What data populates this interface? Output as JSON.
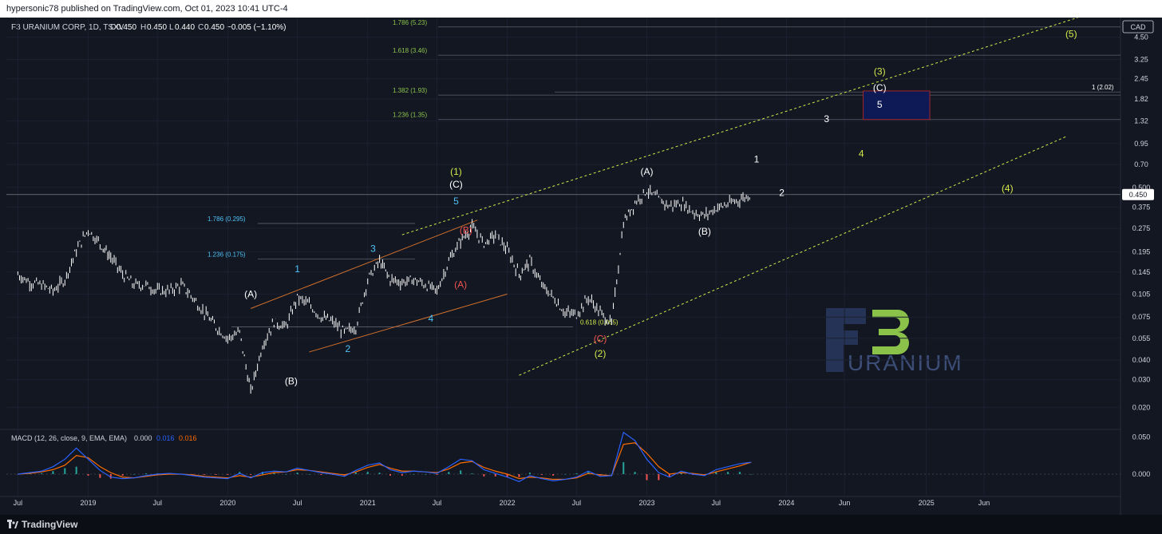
{
  "header": {
    "published": "hypersonic78 published on TradingView.com, Oct 01, 2023 10:41 UTC-4"
  },
  "footer": {
    "brand": "TradingView"
  },
  "legend": {
    "symbol": "F3 URANIUM CORP, 1D, TSXV",
    "o_label": "O",
    "o": "0.450",
    "h_label": "H",
    "h": "0.450",
    "l_label": "L",
    "l": "0.440",
    "c_label": "C",
    "c": "0.450",
    "change": "−0.005 (−1.10%)"
  },
  "currency": "CAD",
  "last_price": "0.450",
  "macd": {
    "label": "MACD (12, 26, close, 9, EMA, EMA)",
    "values": [
      "0.000",
      "0.016",
      "0.016"
    ]
  },
  "watermark": {
    "big": "F3",
    "word": "URANIUM"
  },
  "colors": {
    "background": "#131722",
    "candles": "#ffffff",
    "fib_green": "#8bc34a",
    "fib_cyan": "#4fc3f7",
    "yellow_wave": "#d4e94a",
    "red_wave": "#ef5350",
    "channel_orange": "#d2702c",
    "macd_line": "#2962ff",
    "signal_line": "#ff6d00",
    "target_box_fill": "#0d1a55",
    "target_box_border": "#c62828"
  },
  "chart_data": {
    "type": "candlestick",
    "title": "F3 URANIUM CORP, 1D, TSXV",
    "y_scale": "log",
    "ylim": [
      0.015,
      6.0
    ],
    "y_ticks": [
      "4.50",
      "3.25",
      "2.45",
      "1.82",
      "1.32",
      "0.95",
      "0.70",
      "0.500",
      "0.375",
      "0.275",
      "0.195",
      "0.145",
      "0.105",
      "0.075",
      "0.055",
      "0.040",
      "0.030",
      "0.020"
    ],
    "x_ticks": [
      "Jul",
      "2019",
      "Jul",
      "2020",
      "Jul",
      "2021",
      "Jul",
      "2022",
      "Jul",
      "2023",
      "Jul",
      "2024",
      "Jun",
      "2025",
      "Jun"
    ],
    "price_series": {
      "x": [
        "2018-07-01",
        "2018-08-01",
        "2018-09-01",
        "2018-10-01",
        "2018-11-01",
        "2018-12-01",
        "2019-01-01",
        "2019-02-01",
        "2019-03-01",
        "2019-04-01",
        "2019-05-01",
        "2019-06-01",
        "2019-07-01",
        "2019-08-01",
        "2019-09-01",
        "2019-10-01",
        "2019-11-01",
        "2019-12-01",
        "2020-01-01",
        "2020-02-01",
        "2020-03-01",
        "2020-04-01",
        "2020-05-01",
        "2020-06-01",
        "2020-07-01",
        "2020-08-01",
        "2020-09-01",
        "2020-10-01",
        "2020-11-01",
        "2020-12-01",
        "2021-01-01",
        "2021-02-01",
        "2021-03-01",
        "2021-04-01",
        "2021-05-01",
        "2021-06-01",
        "2021-07-01",
        "2021-08-01",
        "2021-09-01",
        "2021-10-01",
        "2021-11-01",
        "2021-12-01",
        "2022-01-01",
        "2022-02-01",
        "2022-03-01",
        "2022-04-01",
        "2022-05-01",
        "2022-06-01",
        "2022-07-01",
        "2022-08-01",
        "2022-09-01",
        "2022-10-01",
        "2022-11-01",
        "2022-12-01",
        "2023-01-01",
        "2023-02-01",
        "2023-03-01",
        "2023-04-01",
        "2023-05-01",
        "2023-06-01",
        "2023-07-01",
        "2023-08-01",
        "2023-09-01",
        "2023-10-01"
      ],
      "close": [
        0.14,
        0.125,
        0.12,
        0.11,
        0.13,
        0.2,
        0.27,
        0.22,
        0.18,
        0.14,
        0.12,
        0.12,
        0.11,
        0.11,
        0.12,
        0.1,
        0.08,
        0.065,
        0.055,
        0.06,
        0.025,
        0.05,
        0.07,
        0.065,
        0.1,
        0.09,
        0.075,
        0.07,
        0.06,
        0.065,
        0.13,
        0.17,
        0.13,
        0.125,
        0.13,
        0.12,
        0.11,
        0.17,
        0.23,
        0.28,
        0.22,
        0.25,
        0.2,
        0.14,
        0.17,
        0.12,
        0.1,
        0.08,
        0.078,
        0.1,
        0.08,
        0.068,
        0.3,
        0.4,
        0.48,
        0.42,
        0.38,
        0.4,
        0.35,
        0.33,
        0.37,
        0.39,
        0.42,
        0.45
      ]
    },
    "macd_series": {
      "ylim": [
        -0.03,
        0.06
      ],
      "y_ticks": [
        "0.050",
        "0.000"
      ],
      "macd": [
        0,
        0.002,
        0.004,
        0.01,
        0.02,
        0.035,
        0.02,
        0.005,
        -0.004,
        -0.006,
        -0.005,
        -0.002,
        0.0,
        0.001,
        0.0,
        -0.002,
        -0.004,
        -0.005,
        -0.006,
        0.001,
        -0.005,
        0.002,
        0.004,
        0.003,
        0.008,
        0.005,
        0.002,
        0.0,
        -0.003,
        0.005,
        0.012,
        0.015,
        0.006,
        0.002,
        0.004,
        0.003,
        0.001,
        0.01,
        0.02,
        0.018,
        0.006,
        0.001,
        -0.004,
        -0.01,
        -0.002,
        -0.006,
        -0.009,
        -0.007,
        -0.004,
        0.004,
        -0.003,
        -0.002,
        0.056,
        0.045,
        0.02,
        0.002,
        -0.004,
        0.004,
        0.0,
        -0.002,
        0.006,
        0.01,
        0.014,
        0.016
      ],
      "signal": [
        0,
        0.001,
        0.003,
        0.006,
        0.012,
        0.025,
        0.022,
        0.01,
        0.002,
        -0.004,
        -0.005,
        -0.003,
        -0.001,
        0.0,
        0.0,
        -0.001,
        -0.003,
        -0.004,
        -0.005,
        -0.002,
        -0.004,
        -0.001,
        0.002,
        0.003,
        0.006,
        0.005,
        0.003,
        0.001,
        -0.001,
        0.003,
        0.009,
        0.013,
        0.008,
        0.004,
        0.004,
        0.003,
        0.002,
        0.007,
        0.015,
        0.017,
        0.009,
        0.004,
        0.0,
        -0.006,
        -0.004,
        -0.005,
        -0.007,
        -0.007,
        -0.005,
        0.001,
        -0.001,
        -0.002,
        0.04,
        0.042,
        0.028,
        0.01,
        0.0,
        0.002,
        0.001,
        -0.001,
        0.003,
        0.007,
        0.011,
        0.016
      ]
    },
    "fib_levels": [
      {
        "label": "1.786 (5.23)",
        "value": 5.23,
        "color": "fib_green"
      },
      {
        "label": "1.618 (3.46)",
        "value": 3.46,
        "color": "fib_green"
      },
      {
        "label": "1.382 (1.93)",
        "value": 1.93,
        "color": "fib_green"
      },
      {
        "label": "1.236 (1.35)",
        "value": 1.35,
        "color": "fib_green"
      },
      {
        "label": "1 (2.02)",
        "value": 2.02,
        "color": "white"
      },
      {
        "label": "1.786 (0.295)",
        "value": 0.295,
        "color": "fib_cyan"
      },
      {
        "label": "1.236 (0.175)",
        "value": 0.175,
        "color": "fib_cyan"
      },
      {
        "label": "0.618 (0.065)",
        "value": 0.065,
        "color": "yellow_wave"
      }
    ],
    "wave_labels": [
      {
        "text": "(A)",
        "x": "2020-03-01",
        "y": 0.1,
        "color": "white"
      },
      {
        "text": "(B)",
        "x": "2020-06-15",
        "y": 0.028,
        "color": "white"
      },
      {
        "text": "(C)",
        "x": "2021-08-20",
        "y": 0.5,
        "color": "white"
      },
      {
        "text": "(1)",
        "x": "2021-08-20",
        "y": 0.6,
        "color": "yellow_wave"
      },
      {
        "text": "1",
        "x": "2020-07-01",
        "y": 0.145,
        "color": "fib_cyan"
      },
      {
        "text": "2",
        "x": "2020-11-10",
        "y": 0.045,
        "color": "fib_cyan"
      },
      {
        "text": "3",
        "x": "2021-01-15",
        "y": 0.195,
        "color": "fib_cyan"
      },
      {
        "text": "4",
        "x": "2021-06-15",
        "y": 0.07,
        "color": "fib_cyan"
      },
      {
        "text": "5",
        "x": "2021-08-20",
        "y": 0.39,
        "color": "fib_cyan"
      },
      {
        "text": "(B)",
        "x": "2021-09-15",
        "y": 0.255,
        "color": "red_wave"
      },
      {
        "text": "(A)",
        "x": "2021-09-01",
        "y": 0.115,
        "color": "red_wave"
      },
      {
        "text": "(C)",
        "x": "2022-09-01",
        "y": 0.052,
        "color": "red_wave"
      },
      {
        "text": "(2)",
        "x": "2022-09-01",
        "y": 0.042,
        "color": "yellow_wave"
      },
      {
        "text": "(A)",
        "x": "2023-01-01",
        "y": 0.6,
        "color": "white"
      },
      {
        "text": "(B)",
        "x": "2023-06-01",
        "y": 0.25,
        "color": "white"
      },
      {
        "text": "1",
        "x": "2023-10-15",
        "y": 0.72,
        "color": "white"
      },
      {
        "text": "2",
        "x": "2023-12-20",
        "y": 0.44,
        "color": "white"
      },
      {
        "text": "3",
        "x": "2024-04-15",
        "y": 1.3,
        "color": "white"
      },
      {
        "text": "4",
        "x": "2024-07-15",
        "y": 0.78,
        "color": "yellow_wave"
      },
      {
        "text": "(3)",
        "x": "2024-09-01",
        "y": 2.6,
        "color": "yellow_wave"
      },
      {
        "text": "(C)",
        "x": "2024-09-01",
        "y": 2.05,
        "color": "white"
      },
      {
        "text": "5",
        "x": "2024-09-01",
        "y": 1.6,
        "color": "white"
      },
      {
        "text": "(4)",
        "x": "2025-08-01",
        "y": 0.47,
        "color": "yellow_wave"
      },
      {
        "text": "(5)",
        "x": "2026-01-15",
        "y": 4.5,
        "color": "yellow_wave"
      }
    ]
  }
}
